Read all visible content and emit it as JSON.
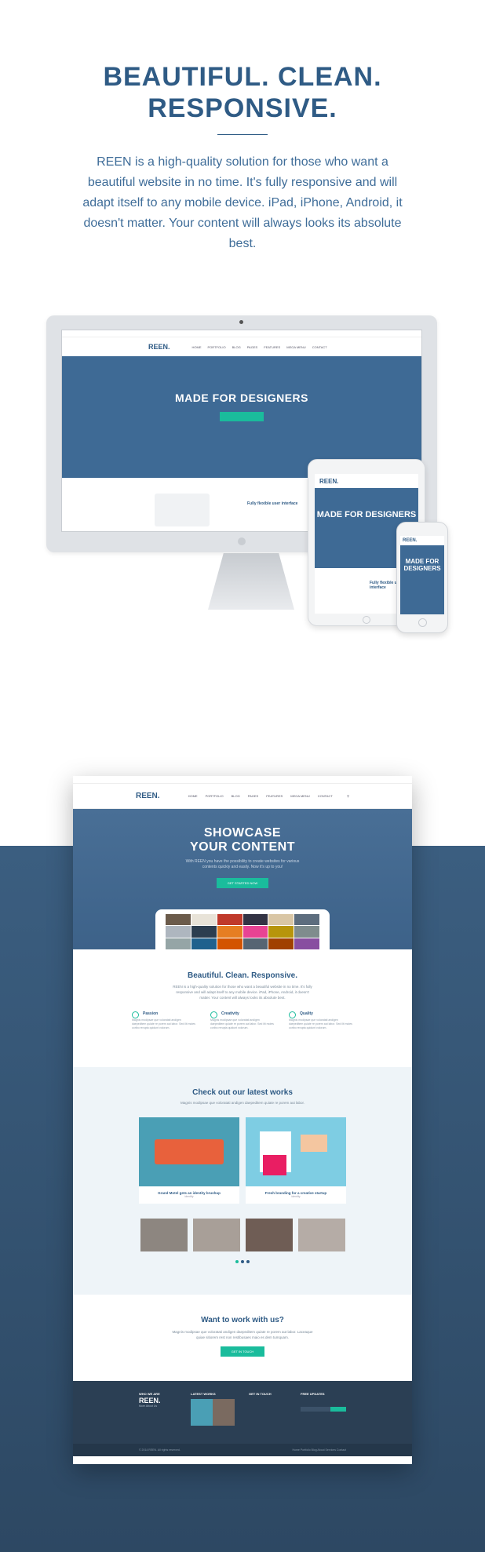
{
  "hero": {
    "title_line1": "BEAUTIFUL. CLEAN.",
    "title_line2": "RESPONSIVE.",
    "description": "REEN is a high-quality solution for those who want a beautiful website in no time. It's fully responsive and will adapt itself to any mobile device. iPad, iPhone, Android, it doesn't matter. Your content will always looks its absolute best."
  },
  "devices": {
    "logo": "REEN.",
    "desktop_headline": "MADE FOR DESIGNERS",
    "tablet_headline": "MADE FOR DESIGNERS",
    "phone_headline": "MADE FOR DESIGNERS",
    "nav": [
      "HOME",
      "PORTFOLIO",
      "BLOG",
      "PAGES",
      "FEATURES",
      "MEGA MENU",
      "CONTACT"
    ],
    "desktop_feature": "Fully flexible user interface",
    "tablet_feature": "Fully flexible user interface"
  },
  "site": {
    "logo": "REEN.",
    "nav": [
      "HOME",
      "PORTFOLIO",
      "BLOG",
      "PAGES",
      "FEATURES",
      "MEGA MENU",
      "CONTACT"
    ],
    "hero_title_1": "SHOWCASE",
    "hero_title_2": "YOUR CONTENT",
    "hero_text": "With REEN you have the possibility to create websites for various contents quickly and easily. Now it's up to you!",
    "hero_button": "GET STARTED NOW",
    "features_title": "Beautiful. Clean. Responsive.",
    "features_text": "REEN is a high-quality solution for those who want a beautiful website in no time. It's fully responsive and will adapt itself to any mobile device. iPad, iPhone, Android, it doesn't matter. Your content will always looks its absolute best.",
    "features": [
      {
        "title": "Passion",
        "text": "Magnis modipsae que voloratati andigen daepeditem quiate re porem aut labor. Sed ilit moles coribo rerupta quidunt volorum."
      },
      {
        "title": "Creativity",
        "text": "Magnis modipsae que voloratati andigen daepeditem quiate re porem aut labor. Sed ilit moles coribo rerupta quidunt volorum."
      },
      {
        "title": "Quality",
        "text": "Magnis modipsae que voloratati andigen daepeditem quiate re porem aut labor. Sed ilit moles coribo rerupta quidunt volorum."
      }
    ],
    "works_title": "Check out our latest works",
    "works_text": "Magnis modipsae que voloratati andigen daepeditem quiate re porem aut labor.",
    "works": [
      {
        "title": "Grand Motel gets an identity brushup",
        "tag": "identity"
      },
      {
        "title": "Fresh branding for a creative startup",
        "tag": "identity"
      }
    ],
    "cta_title": "Want to work with us?",
    "cta_text": "Magnis modipsae que voloratati andigen daepeditem quiate re porem aut labor. Laceaque quiae sitiorem rest non restibusaes maio es dem tumquam.",
    "cta_button": "GET IN TOUCH",
    "footer": {
      "col1_title": "WHO WE ARE",
      "col2_title": "LATEST WORKS",
      "col3_title": "GET IN TOUCH",
      "col4_title": "FREE UPDATES",
      "more_about": "More About Us"
    },
    "copyright": "© 2014 REEN. All rights reserved.",
    "bottom_links": "Home  Portfolio  Blog  About  Services  Contact"
  }
}
